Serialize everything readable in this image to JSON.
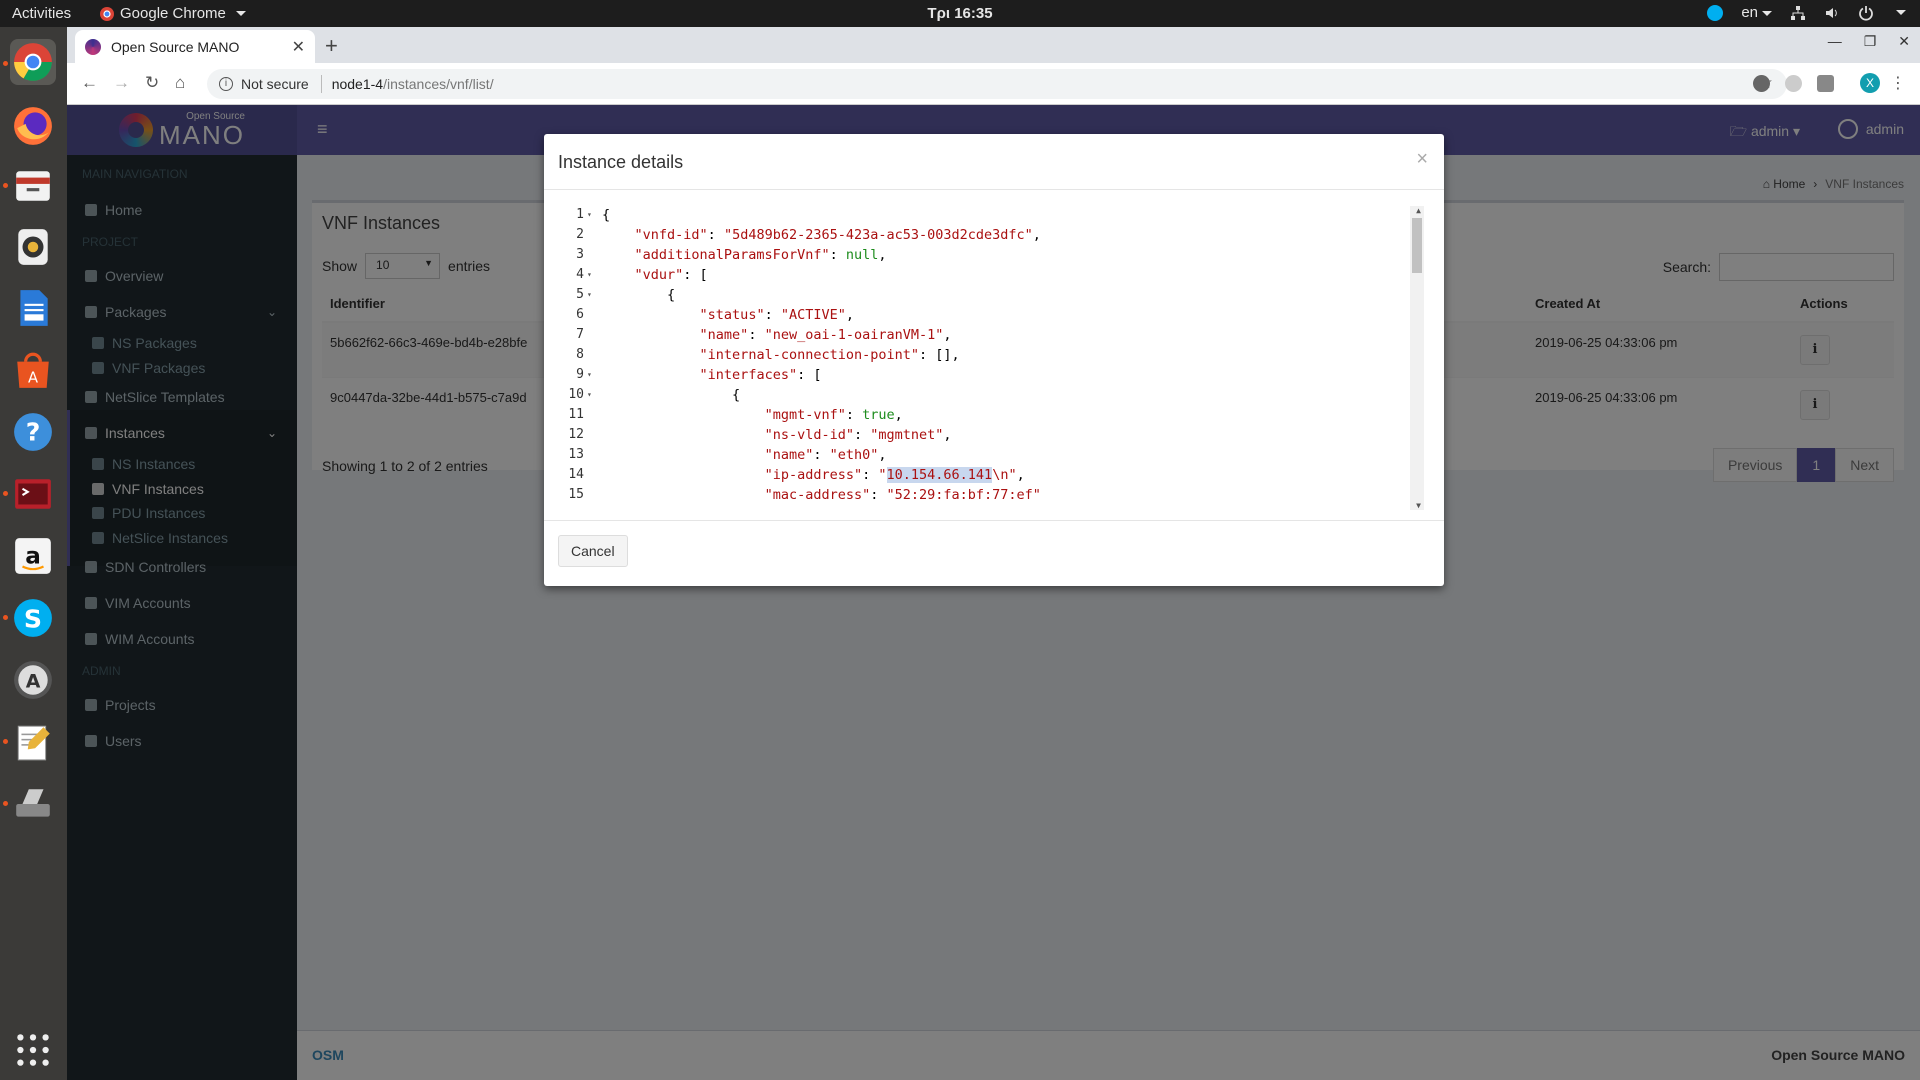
{
  "topbar": {
    "activities": "Activities",
    "app_name": "Google Chrome",
    "clock": "Τρι 16:35",
    "lang": "en"
  },
  "dock": {
    "items": [
      "chrome-icon",
      "firefox-icon",
      "files-icon",
      "rhythmbox-icon",
      "writer-icon",
      "software-icon",
      "help-icon",
      "terminal-icon",
      "amazon-icon",
      "skype-icon",
      "updater-icon",
      "text-editor-icon",
      "scanner-icon",
      "apps-grid-icon"
    ]
  },
  "browser": {
    "tab_title": "Open Source MANO",
    "security": "Not secure",
    "url_host": "node1-4",
    "url_path": "/instances/vnf/list/",
    "profile_letter": "X"
  },
  "app": {
    "logo_small": "Open Source",
    "logo_big": "MANO",
    "header_project": "admin",
    "header_user": "admin",
    "sidebar": {
      "main_nav": "MAIN NAVIGATION",
      "home": "Home",
      "project": "PROJECT",
      "overview": "Overview",
      "packages": "Packages",
      "ns_packages": "NS Packages",
      "vnf_packages": "VNF Packages",
      "netslice_templates": "NetSlice Templates",
      "instances": "Instances",
      "ns_instances": "NS Instances",
      "vnf_instances": "VNF Instances",
      "pdu_instances": "PDU Instances",
      "netslice_instances": "NetSlice Instances",
      "sdn_controllers": "SDN Controllers",
      "vim_accounts": "VIM Accounts",
      "wim_accounts": "WIM Accounts",
      "admin": "ADMIN",
      "projects": "Projects",
      "users": "Users"
    },
    "breadcrumb": {
      "home": "Home",
      "current": "VNF Instances"
    },
    "box_title": "VNF Instances",
    "show_label": "Show",
    "show_value": "10",
    "entries_label": "entries",
    "search_label": "Search:",
    "columns": {
      "identifier": "Identifier",
      "created_at": "Created At",
      "actions": "Actions"
    },
    "rows": [
      {
        "id": "5b662f62-66c3-469e-bd4b-e28bfe",
        "created": "2019-06-25 04:33:06 pm"
      },
      {
        "id": "9c0447da-32be-44d1-b575-c7a9d",
        "created": "2019-06-25 04:33:06 pm"
      }
    ],
    "showing": "Showing 1 to 2 of 2 entries",
    "pager": {
      "prev": "Previous",
      "page": "1",
      "next": "Next"
    },
    "footer_left": "OSM",
    "footer_right": "Open Source MANO"
  },
  "modal": {
    "title": "Instance details",
    "close": "×",
    "cancel": "Cancel",
    "line_numbers": [
      "1",
      "2",
      "3",
      "4",
      "5",
      "6",
      "7",
      "8",
      "9",
      "10",
      "11",
      "12",
      "13",
      "14",
      "15"
    ]
  }
}
